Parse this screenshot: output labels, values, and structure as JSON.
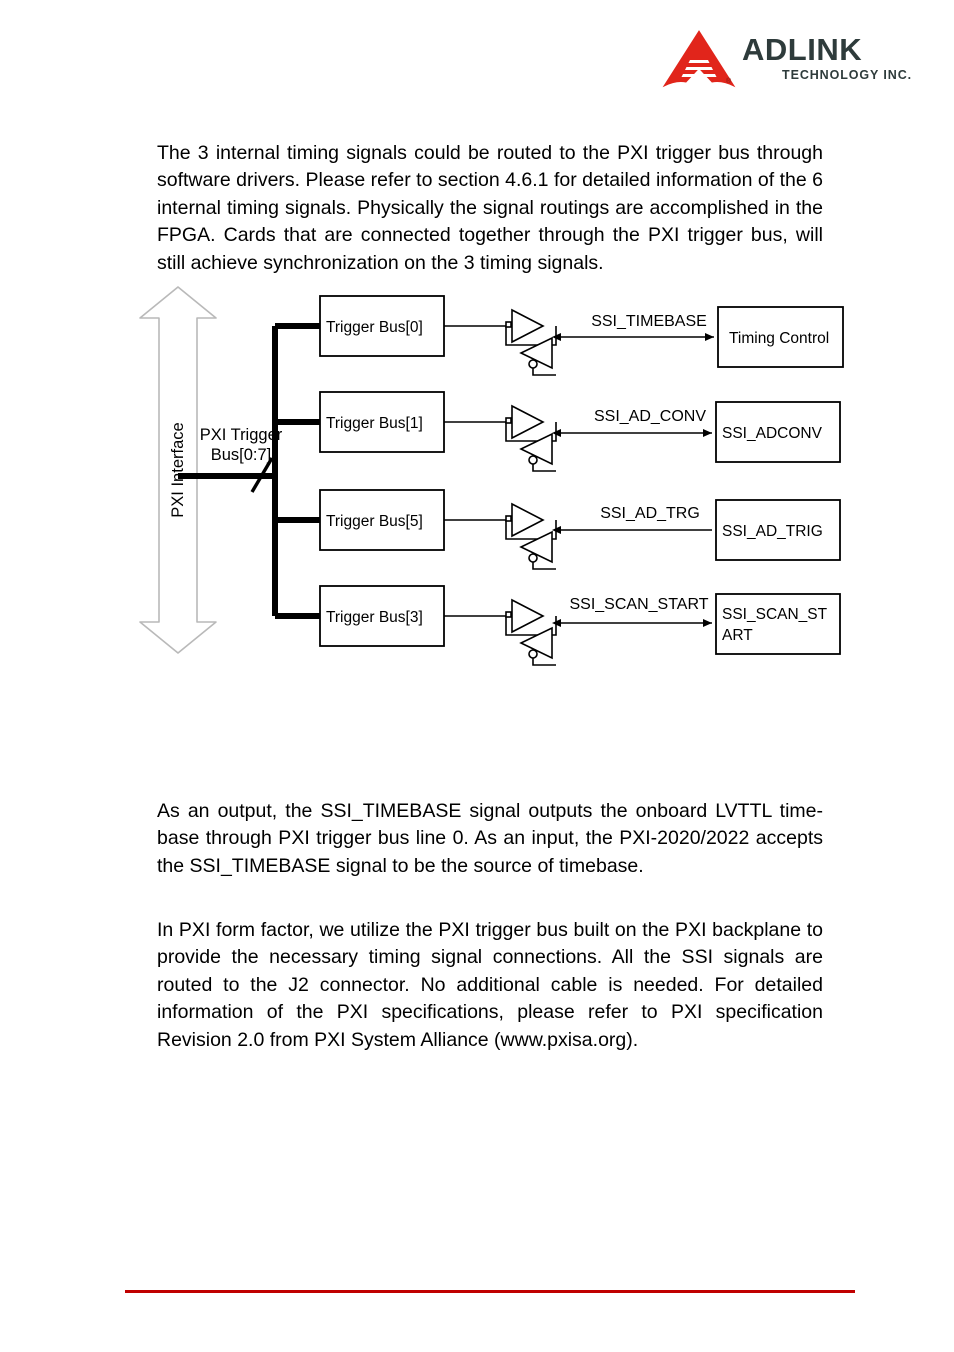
{
  "header": {
    "logo_icon": "adlink-triangle-logo",
    "brand_name": "ADLINK",
    "brand_tagline": "TECHNOLOGY INC.",
    "registered_mark": "®",
    "brand_color": "#e1251b",
    "wordmark_color": "#2e3b3b"
  },
  "body": {
    "paragraph_intro": "The 3 internal timing signals could be routed to the PXI trigger bus through software drivers. Please refer to section 4.6.1 for detailed information of the 6 internal timing signals. Physically the signal routings are accomplished in the FPGA. Cards that are connected together through the PXI trigger bus, will still achieve synchronization on the 3 timing signals.",
    "paragraph_output": "As an output, the SSI_TIMEBASE signal outputs the onboard LVTTL time-base through PXI trigger bus line 0. As an input, the PXI-2020/2022 accepts the SSI_TIMEBASE signal to be the source of timebase.",
    "paragraph_formfactor": "In PXI form factor, we utilize the PXI trigger bus built on the PXI backplane to provide the necessary timing signal connections. All the SSI signals are routed to the J2 connector. No additional cable is needed. For detailed information of the PXI specifications, please refer to PXI specification Revision 2.0 from PXI System Alliance (www.pxisa.org)."
  },
  "diagram": {
    "interface_arrow_label": "PXI Interface",
    "bus_label_line1": "PXI Trigger",
    "bus_label_line2": "Bus[0:7]",
    "bus_slash_marker": "bus-width-slash",
    "rows": [
      {
        "trigger_box": "Trigger Bus[0]",
        "buffer_icon": "tristate-buffer-pair",
        "signal_label": "SSI_TIMEBASE",
        "arrow_type": "double-headed",
        "dest_box_line1": "Timing Control",
        "dest_box_line2": ""
      },
      {
        "trigger_box": "Trigger Bus[1]",
        "buffer_icon": "tristate-buffer-pair",
        "signal_label": "SSI_AD_CONV",
        "arrow_type": "double-headed",
        "dest_box_line1": "SSI_ADCONV",
        "dest_box_line2": ""
      },
      {
        "trigger_box": "Trigger Bus[5]",
        "buffer_icon": "tristate-buffer-pair",
        "signal_label": "SSI_AD_TRG",
        "arrow_type": "left-headed",
        "dest_box_line1": "SSI_AD_TRIG",
        "dest_box_line2": ""
      },
      {
        "trigger_box": "Trigger Bus[3]",
        "buffer_icon": "tristate-buffer-pair",
        "signal_label": "SSI_SCAN_START",
        "arrow_type": "double-headed",
        "dest_box_line1": "SSI_SCAN_ST",
        "dest_box_line2": "ART"
      }
    ]
  },
  "footer": {
    "rule_color": "#c00000"
  }
}
